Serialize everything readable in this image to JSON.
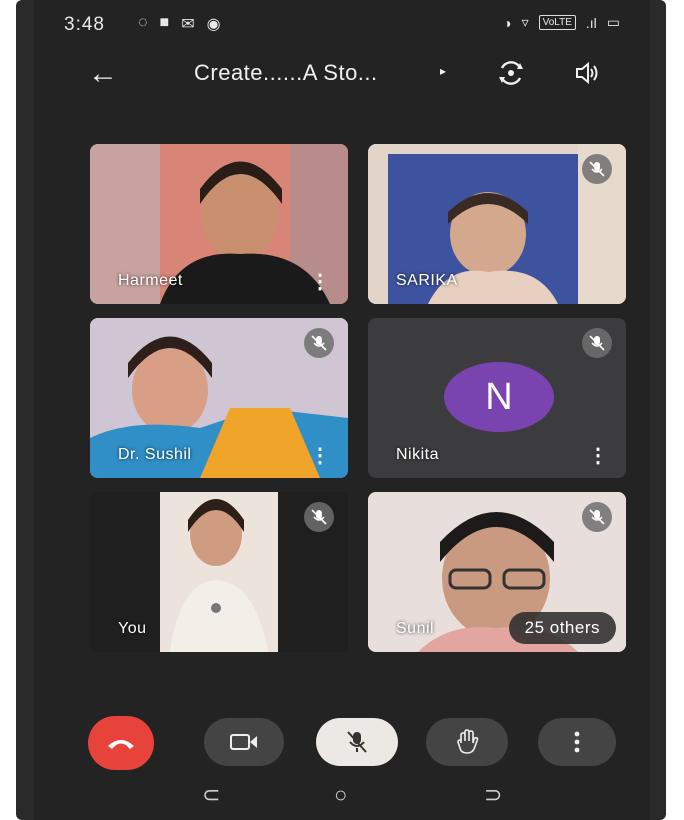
{
  "status_bar": {
    "time": "3:48",
    "left_icons": [
      "◌",
      "■",
      "✉",
      "◉"
    ],
    "right_icons": [
      "◑",
      "▿"
    ],
    "volte_label": "VoLTE",
    "signal": ".ıl",
    "battery": "▭"
  },
  "toolbar": {
    "back_icon": "←",
    "title": "Create......A Sto...",
    "caret": "▸"
  },
  "tiles": [
    {
      "name": "Harmeet",
      "menu": "⋮"
    },
    {
      "name": "SARIKA"
    },
    {
      "name": "Dr. Sushil",
      "menu": "⋮"
    },
    {
      "name": "Nikita",
      "menu": "⋮",
      "avatar_letter": "N"
    },
    {
      "name": "You"
    },
    {
      "name": "Sunil",
      "others": "25 others"
    }
  ],
  "colors": {
    "end_call": "#e8433a",
    "avatar": "#7a44b0",
    "background": "#232323"
  },
  "nav": {
    "back": "⊂",
    "home": "○",
    "recent": "⊃"
  }
}
